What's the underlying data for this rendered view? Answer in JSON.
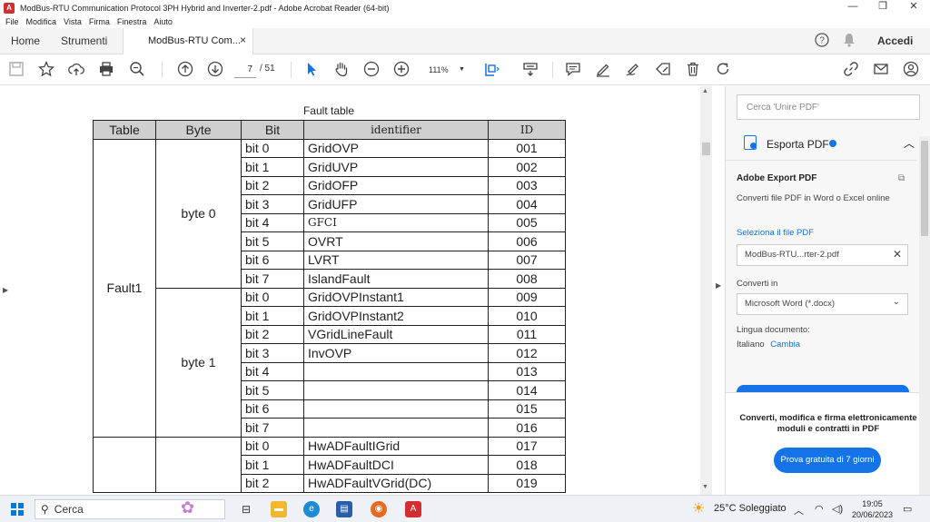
{
  "window": {
    "title": "ModBus-RTU Communication Protocol 3PH Hybrid and Inverter-2.pdf - Adobe Acrobat Reader (64-bit)",
    "app_icon": "acrobat-icon"
  },
  "menu": [
    "File",
    "Modifica",
    "Vista",
    "Firma",
    "Finestra",
    "Aiuto"
  ],
  "tabs": {
    "home": "Home",
    "tools": "Strumenti",
    "document": "ModBus-RTU Com...",
    "close": "×",
    "help_icon": "?",
    "signin": "Accedi"
  },
  "toolbar": {
    "page_current": "7",
    "page_total": "/ 51",
    "zoom": "111%"
  },
  "document": {
    "caption": "Fault table",
    "headers": [
      "Table",
      "Byte",
      "Bit",
      "identifier",
      "ID"
    ],
    "table_group": "Fault1",
    "byte_groups": [
      "byte 0",
      "byte 1"
    ],
    "rows": [
      {
        "bit": "bit 0",
        "identifier": "GridOVP",
        "id": "001"
      },
      {
        "bit": "bit 1",
        "identifier": "GridUVP",
        "id": "002"
      },
      {
        "bit": "bit 2",
        "identifier": "GridOFP",
        "id": "003"
      },
      {
        "bit": "bit 3",
        "identifier": "GridUFP",
        "id": "004"
      },
      {
        "bit": "bit 4",
        "identifier": "GFCI",
        "id": "005"
      },
      {
        "bit": "bit 5",
        "identifier": "OVRT",
        "id": "006"
      },
      {
        "bit": "bit 6",
        "identifier": "LVRT",
        "id": "007"
      },
      {
        "bit": "bit 7",
        "identifier": "IslandFault",
        "id": "008"
      },
      {
        "bit": "bit 0",
        "identifier": "GridOVPInstant1",
        "id": "009"
      },
      {
        "bit": "bit 1",
        "identifier": "GridOVPInstant2",
        "id": "010"
      },
      {
        "bit": "bit 2",
        "identifier": "VGridLineFault",
        "id": "011"
      },
      {
        "bit": "bit 3",
        "identifier": "InvOVP",
        "id": "012"
      },
      {
        "bit": "bit 4",
        "identifier": "",
        "id": "013"
      },
      {
        "bit": "bit 5",
        "identifier": "",
        "id": "014"
      },
      {
        "bit": "bit 6",
        "identifier": "",
        "id": "015"
      },
      {
        "bit": "bit 7",
        "identifier": "",
        "id": "016"
      },
      {
        "bit": "bit 0",
        "identifier": "HwADFaultIGrid",
        "id": "017"
      },
      {
        "bit": "bit 1",
        "identifier": "HwADFaultDCI",
        "id": "018"
      },
      {
        "bit": "bit 2",
        "identifier": "HwADFaultVGrid(DC)",
        "id": "019"
      }
    ]
  },
  "side_panel": {
    "search_placeholder": "Cerca 'Unire PDF'",
    "export_label": "Esporta PDF",
    "adobe_title": "Adobe Export PDF",
    "adobe_desc": "Converti file PDF in Word o Excel online",
    "select_label": "Seleziona il file PDF",
    "file_name": "ModBus-RTU...rter-2.pdf",
    "convert_label": "Converti in",
    "convert_value": "Microsoft Word (*.docx)",
    "lang_label": "Lingua documento:",
    "lang_value": "Italiano",
    "lang_change": "Cambia",
    "promo_line1": "Converti, modifica e firma elettronicamente",
    "promo_line2": "moduli e contratti in PDF",
    "promo_button": "Prova gratuita di 7 giorni"
  },
  "taskbar": {
    "search_label": "Cerca",
    "weather": "25°C  Soleggiato",
    "time": "19:05",
    "date": "20/06/2023"
  },
  "colors": {
    "accent": "#1473e6",
    "acrobat_red": "#d32f2f",
    "table_header": "#cfcfcf"
  }
}
